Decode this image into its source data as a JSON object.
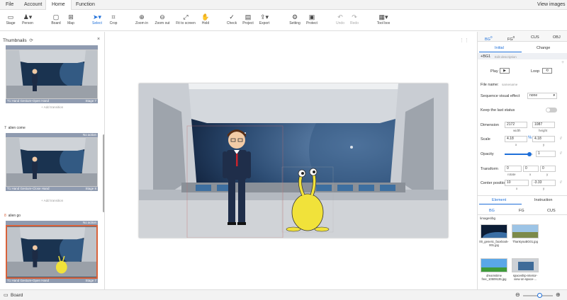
{
  "menu": {
    "file": "File",
    "account": "Account",
    "home": "Home",
    "function": "Function",
    "view_images": "View images"
  },
  "toolbar": {
    "stage": "Stage",
    "person": "Person",
    "board": "Board",
    "map": "Map",
    "select": "Select",
    "crop": "Crop",
    "zoom_in": "Zoom in",
    "zoom_out": "Zoom out",
    "fit": "Fit to screen",
    "hold": "Hold",
    "check": "Check",
    "project": "Project",
    "export": "Export",
    "setting": "Setting",
    "protect": "Protect",
    "undo": "Undo",
    "redo": "Redo",
    "toolbox": "Tool box"
  },
  "thumbnails": {
    "title": "Thumbnails",
    "items": [
      {
        "number": "",
        "name": "",
        "caption": "T1 Hand Gesture-Open Hand",
        "stage": "Stage 7",
        "action": "",
        "add": "+ Add transition"
      },
      {
        "number": "7",
        "name": "alien come",
        "caption": "T1 Hand Gesture-Close Hand",
        "stage": "Stage 8",
        "action": "No action",
        "add": "+ Add transition"
      },
      {
        "number": "8",
        "name": "alien go",
        "caption": "T1 Hand Gesture-Open Hand",
        "stage": "Stage 7",
        "action": "No action",
        "add": ""
      }
    ]
  },
  "right": {
    "tabs": [
      "BG",
      "FG",
      "CUS",
      "OBJ"
    ],
    "bg_count": "0",
    "fg_count": "0",
    "subtabs": [
      "Initial",
      "Change"
    ],
    "bg_name": "+BG1",
    "edit_desc": "Edit description",
    "play": "Play",
    "loop": "Loop",
    "file_name_label": "File name:",
    "file_name": "samename",
    "seq_label": "Sequence visual effect",
    "seq_value": "none",
    "keep_label": "Keep the last status",
    "dimension_label": "Dimension",
    "width": "2172",
    "height": "1087",
    "width_lbl": "width",
    "height_lbl": "height",
    "scale_label": "Scale",
    "scale_x": "4.18",
    "scale_y": "4.18",
    "x_lbl": "x",
    "y_lbl": "y",
    "opacity_label": "Opacity",
    "opacity": "1",
    "opacity_level": 0.88,
    "transform_label": "Transform",
    "rotate": "0",
    "tx": "0",
    "ty": "0",
    "rotate_lbl": "rotate",
    "center_label": "Center position",
    "cx": "10",
    "cy": "-3.33",
    "lower_tabs": [
      "Element",
      "Instruction"
    ],
    "lower_sub": [
      "BG",
      "FG",
      "CUS"
    ],
    "path": "\\images\\bg",
    "images": [
      "00_generic_facebook-001.jpg",
      "ThankyouBG01.jpg",
      "dreamstime free_10509135.jpg",
      "spaceship-interior-view-on-space-..."
    ]
  },
  "status": {
    "board": "Board",
    "zoom_level": 0.55
  },
  "colors": {
    "accent": "#1e6fd9",
    "selected": "#d9623b",
    "thumb_bar": "#8f9bb0"
  }
}
